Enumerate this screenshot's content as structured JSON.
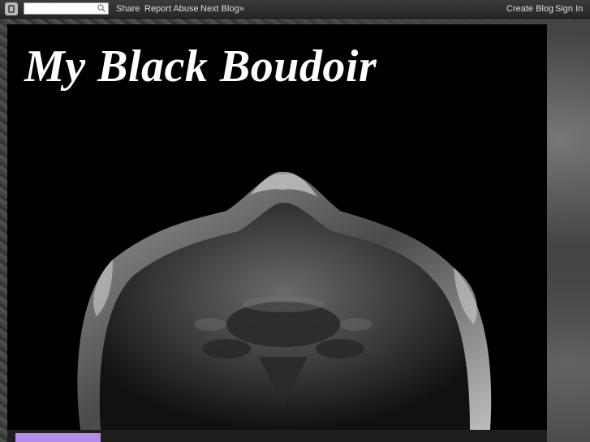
{
  "navbar": {
    "logo_icon": "blogger-icon",
    "search_placeholder": "",
    "links_left": [
      "Share",
      "Report Abuse",
      "Next Blog»"
    ],
    "links_right": [
      "Create Blog",
      "Sign In"
    ]
  },
  "header": {
    "title": "My Black Boudoir"
  },
  "colors": {
    "navbar_bg": "#2f2f2f",
    "panel_bg": "#000000",
    "title_color": "#ffffff",
    "accent_tab": "#b48ce8"
  }
}
